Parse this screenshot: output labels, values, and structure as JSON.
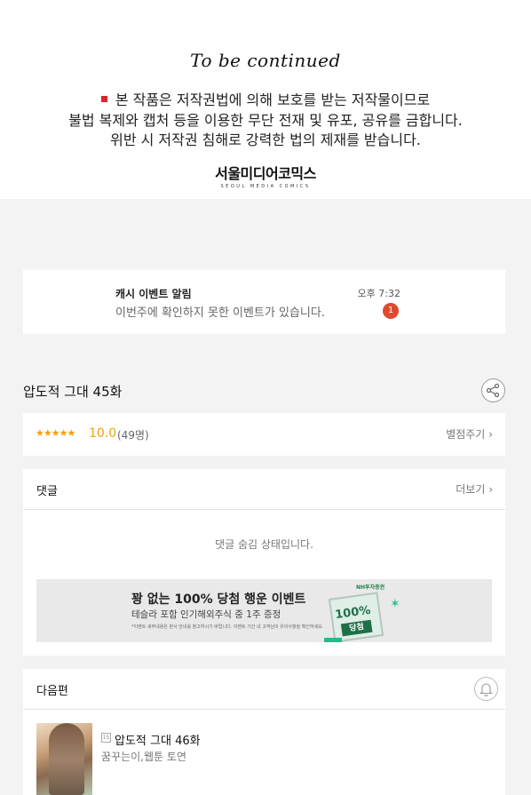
{
  "notice": {
    "to_be_continued": "To be continued",
    "lines": [
      "본 작품은 저작권법에 의해 보호를 받는 저작물이므로",
      "불법 복제와 캡처 등을 이용한 무단 전재 및 유포, 공유를 금합니다.",
      "위반 시 저작권 침해로 강력한 법의 제재를 받습니다."
    ],
    "publisher_name": "서울미디어코믹스",
    "publisher_sub": "SEOUL MEDIA COMICS"
  },
  "alert": {
    "title": "캐시 이벤트 알림",
    "message": "이번주에 확인하지 못한 이벤트가 있습니다.",
    "time": "오후 7:32",
    "badge": "1"
  },
  "episode": {
    "title": "압도적 그대 45화"
  },
  "rating": {
    "stars": "★★★★★",
    "score": "10.0",
    "count": "(49명)",
    "give_label": "별점주기",
    "chevron": "›"
  },
  "comments": {
    "label": "댓글",
    "more_label": "더보기",
    "chevron": "›",
    "hidden_message": "댓글 숨김 상태입니다."
  },
  "ad": {
    "headline": "꽝 없는 100% 당첨 행운 이벤트",
    "sub": "테슬라 포함 인기해외주식 중 1주 증정",
    "fine_print": "*이벤트 세부내용은 본사 안내를 참고하시기 바랍니다. 이벤트 기간 내 고객님의 유의사항을 확인하세요.",
    "brand": "NH투자증권",
    "card_percent": "100%",
    "card_win": "당첨",
    "sparkle": "✶"
  },
  "next_episode": {
    "label": "다음편",
    "age": "15",
    "title": "압도적 그대 46화",
    "author": "꿈꾸는이,웹툰 토연"
  },
  "colors": {
    "accent_orange": "#f0a30a",
    "badge_red": "#e0492f",
    "nh_green": "#1f6f48"
  }
}
